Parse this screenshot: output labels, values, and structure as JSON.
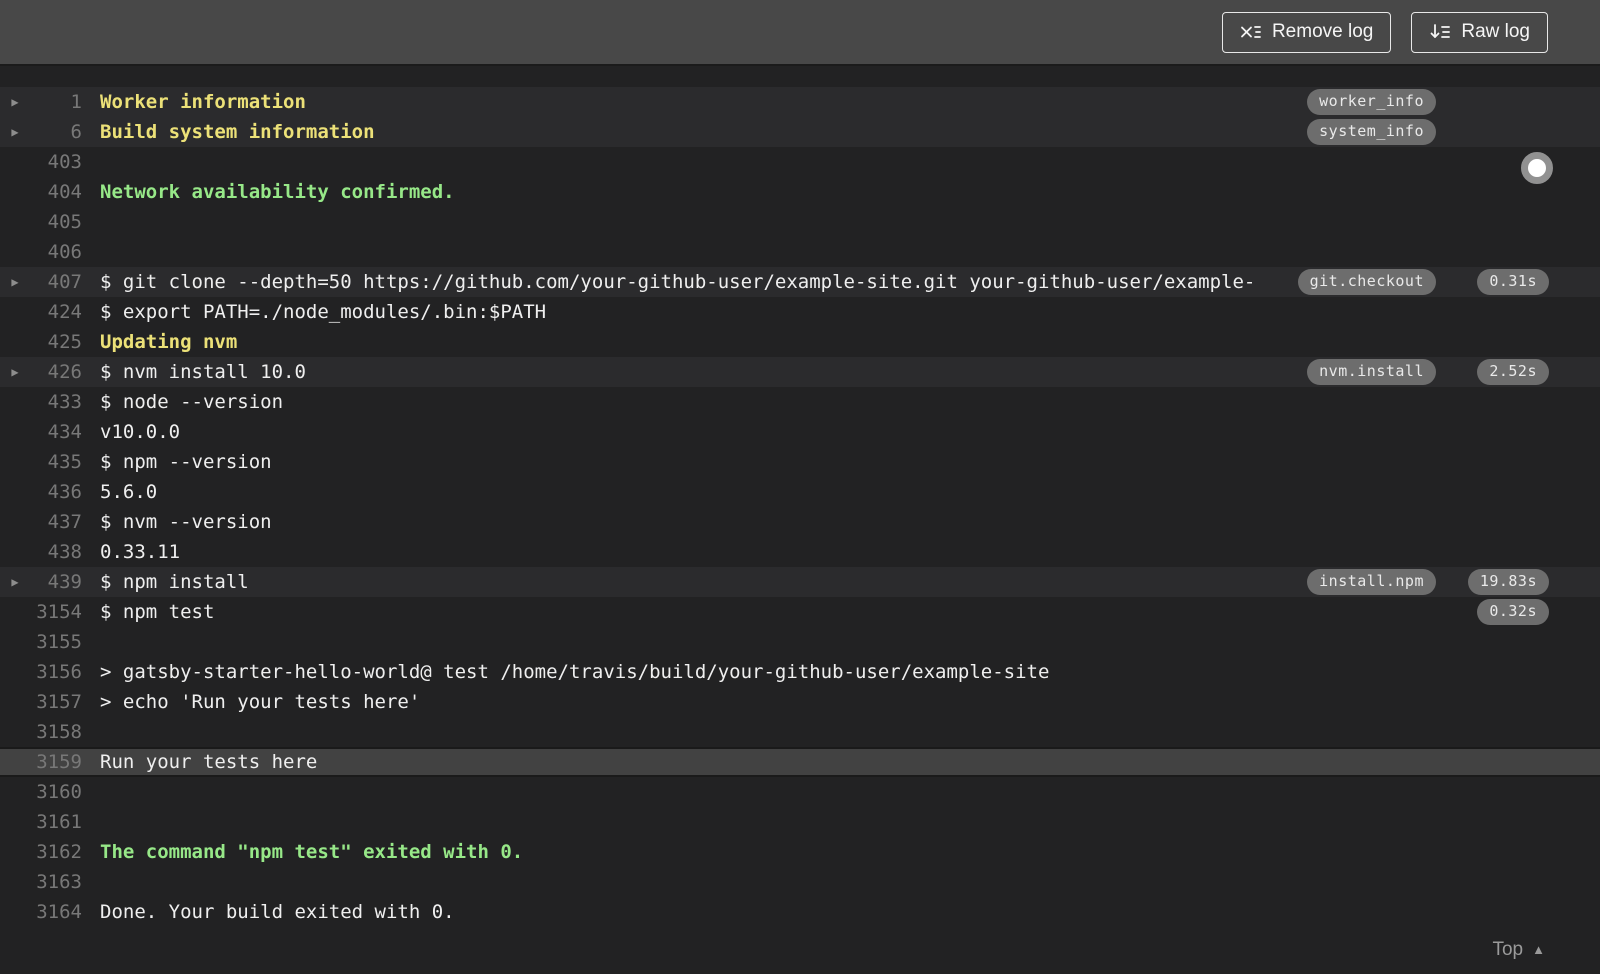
{
  "header": {
    "remove_log_label": "Remove log",
    "raw_log_label": "Raw log"
  },
  "colors": {
    "header_bg": "#484848",
    "log_bg": "#222223",
    "fold_row_bg": "#2b2b2d",
    "selected_row_bg": "#424242",
    "section_yellow": "#ece178",
    "success_green": "#97e888",
    "badge_bg": "#6d6d6d",
    "line_number_gray": "#787878"
  },
  "log": {
    "rows": [
      {
        "num": "1",
        "text": "Worker information",
        "style": "yellow",
        "fold": true,
        "badge": "worker_info"
      },
      {
        "num": "6",
        "text": "Build system information",
        "style": "yellow",
        "fold": true,
        "badge": "system_info"
      },
      {
        "num": "403",
        "text": ""
      },
      {
        "num": "404",
        "text": "Network availability confirmed.",
        "style": "green"
      },
      {
        "num": "405",
        "text": ""
      },
      {
        "num": "406",
        "text": ""
      },
      {
        "num": "407",
        "text": "$ git clone --depth=50 https://github.com/your-github-user/example-site.git your-github-user/example-",
        "fold": true,
        "badge": "git.checkout",
        "duration": "0.31s"
      },
      {
        "num": "424",
        "text": "$ export PATH=./node_modules/.bin:$PATH"
      },
      {
        "num": "425",
        "text": "Updating nvm",
        "style": "yellow"
      },
      {
        "num": "426",
        "text": "$ nvm install 10.0",
        "fold": true,
        "badge": "nvm.install",
        "duration": "2.52s"
      },
      {
        "num": "433",
        "text": "$ node --version"
      },
      {
        "num": "434",
        "text": "v10.0.0"
      },
      {
        "num": "435",
        "text": "$ npm --version"
      },
      {
        "num": "436",
        "text": "5.6.0"
      },
      {
        "num": "437",
        "text": "$ nvm --version"
      },
      {
        "num": "438",
        "text": "0.33.11"
      },
      {
        "num": "439",
        "text": "$ npm install",
        "fold": true,
        "badge": "install.npm",
        "duration": "19.83s"
      },
      {
        "num": "3154",
        "text": "$ npm test",
        "duration": "0.32s"
      },
      {
        "num": "3155",
        "text": ""
      },
      {
        "num": "3156",
        "text": "> gatsby-starter-hello-world@ test /home/travis/build/your-github-user/example-site"
      },
      {
        "num": "3157",
        "text": "> echo 'Run your tests here'"
      },
      {
        "num": "3158",
        "text": ""
      },
      {
        "num": "3159",
        "text": "Run your tests here",
        "selected": true
      },
      {
        "num": "3160",
        "text": ""
      },
      {
        "num": "3161",
        "text": ""
      },
      {
        "num": "3162",
        "text": "The command \"npm test\" exited with 0.",
        "style": "green"
      },
      {
        "num": "3163",
        "text": ""
      },
      {
        "num": "3164",
        "text": "Done. Your build exited with 0."
      }
    ],
    "fold_arrow_glyph": "▶",
    "footer": {
      "top_label": "Top",
      "top_arrow_glyph": "▲"
    }
  }
}
